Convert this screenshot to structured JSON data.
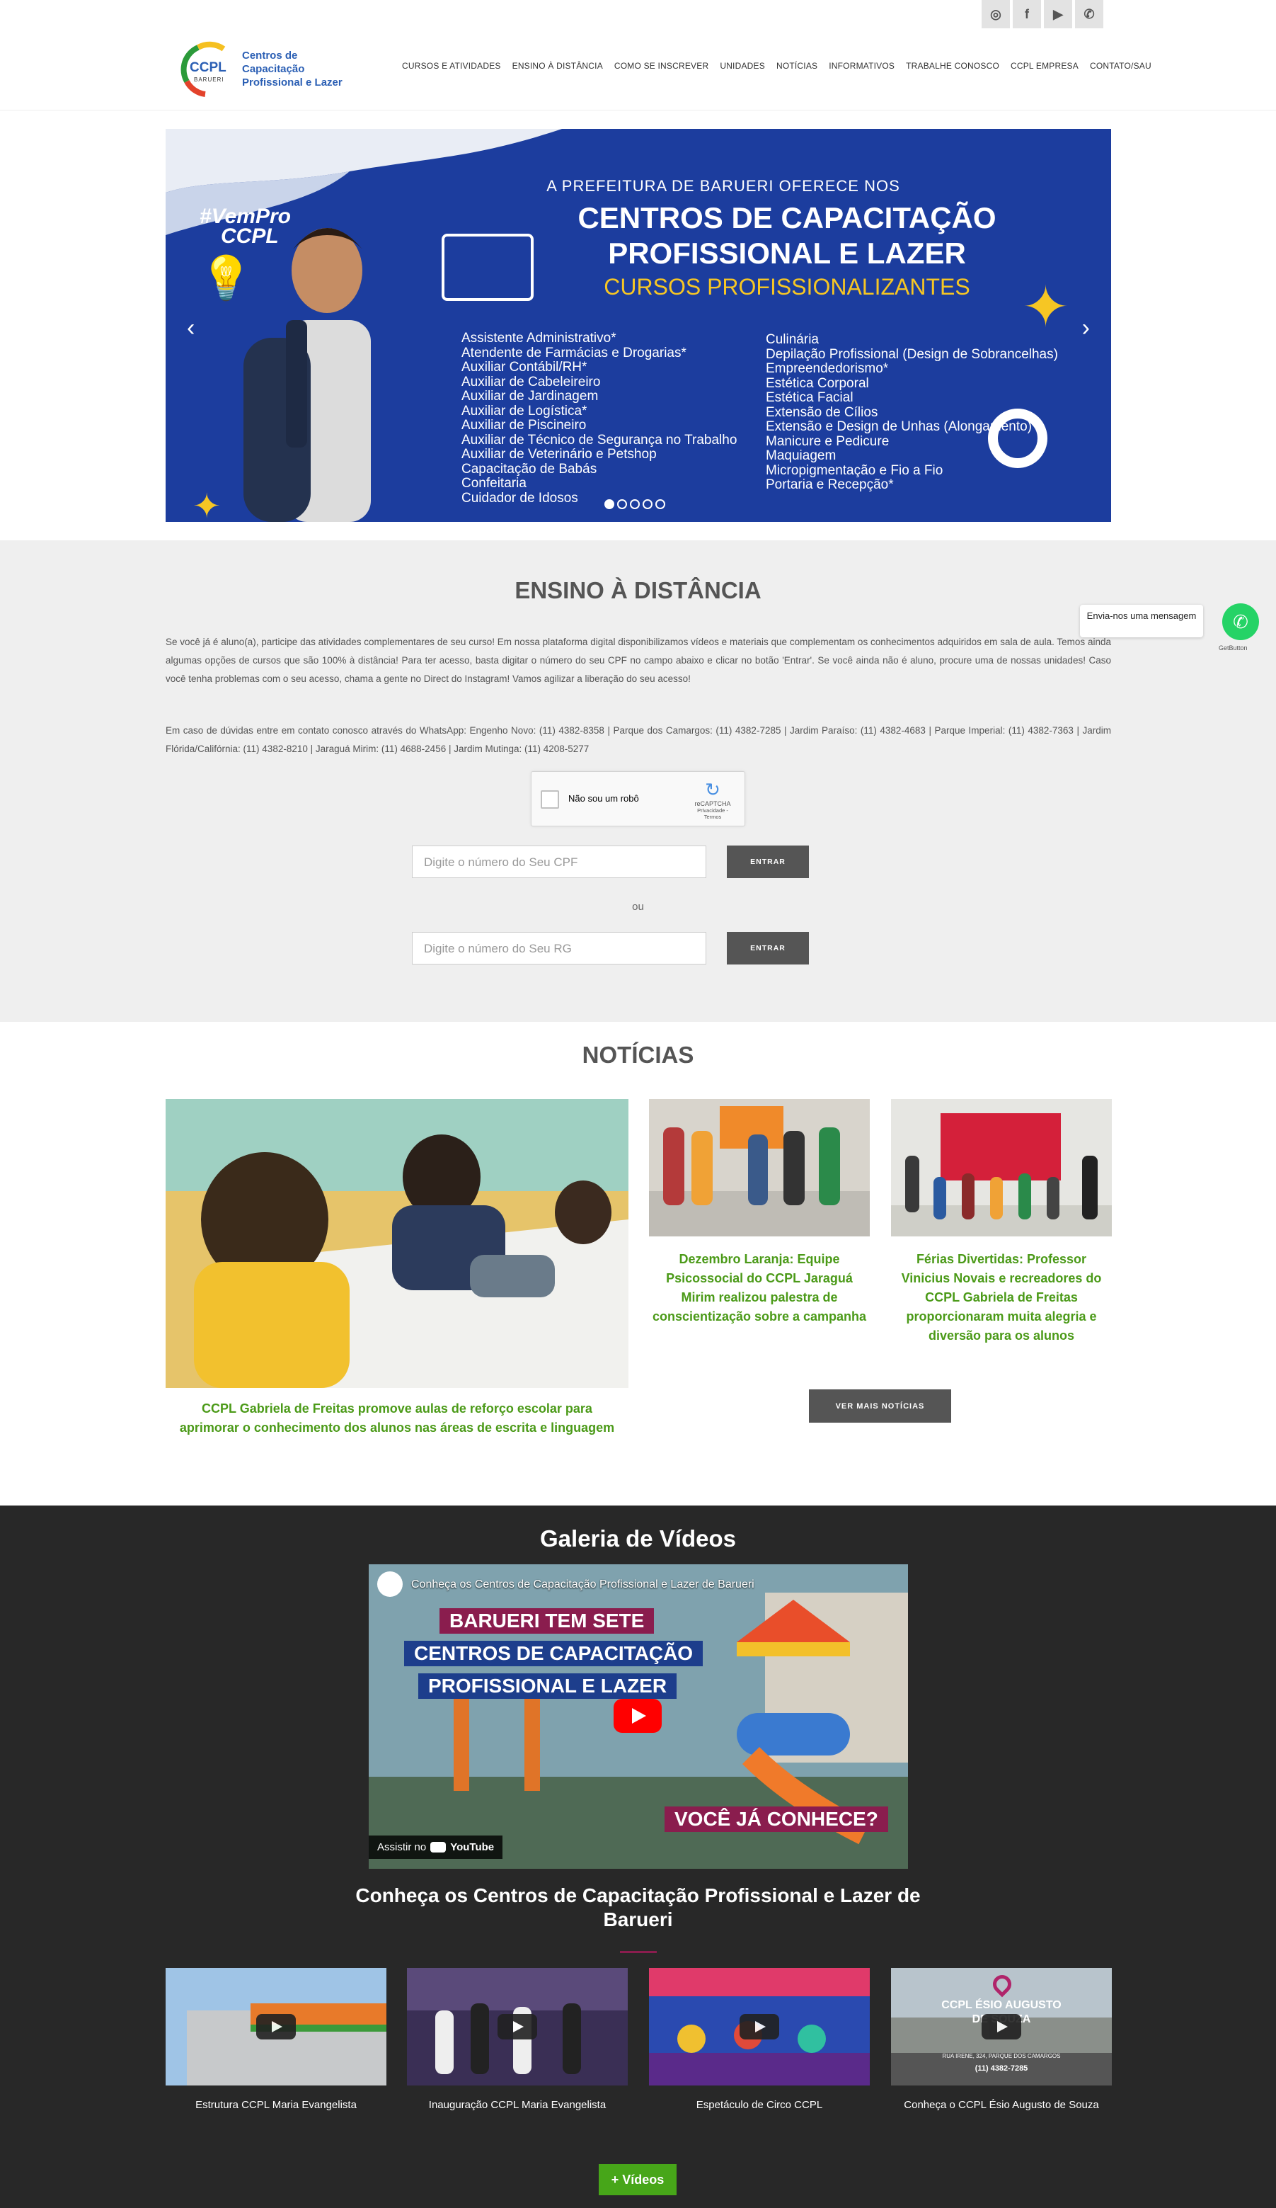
{
  "social": {
    "items": [
      {
        "icon": "instagram-icon",
        "glyph": "◎"
      },
      {
        "icon": "facebook-icon",
        "glyph": "f"
      },
      {
        "icon": "youtube-icon",
        "glyph": "▶"
      },
      {
        "icon": "whatsapp-icon",
        "glyph": "✆"
      }
    ]
  },
  "header": {
    "logo_abbr": "CCPL",
    "logo_city": "BARUERI",
    "logo_line1": "Centros de Capacitação",
    "logo_line2": "Profissional e Lazer",
    "nav": [
      "CURSOS E ATIVIDADES",
      "ENSINO À DISTÂNCIA",
      "COMO SE INSCREVER",
      "UNIDADES",
      "NOTÍCIAS",
      "INFORMATIVOS",
      "TRABALHE CONOSCO",
      "CCPL EMPRESA",
      "CONTATO/SAU"
    ]
  },
  "banner": {
    "hashtag_line1": "#VemPro",
    "hashtag_line2": "CCPL",
    "subtitle": "A PREFEITURA DE BARUERI OFERECE NOS",
    "title1": "CENTROS DE CAPACITAÇÃO",
    "title2": "PROFISSIONAL E LAZER",
    "title3": "CURSOS PROFISSIONALIZANTES",
    "courses_left": [
      "Assistente Administrativo*",
      "Atendente de Farmácias e Drogarias*",
      "Auxiliar Contábil/RH*",
      "Auxiliar de Cabeleireiro",
      "Auxiliar de Jardinagem",
      "Auxiliar de Logística*",
      "Auxiliar de Piscineiro",
      "Auxiliar de Técnico de Segurança no Trabalho",
      "Auxiliar de Veterinário e Petshop",
      "Capacitação de Babás",
      "Confeitaria",
      "Cuidador de Idosos"
    ],
    "courses_right": [
      "Culinária",
      "Depilação Profissional (Design de Sobrancelhas)",
      "Empreendedorismo*",
      "Estética Corporal",
      "Estética Facial",
      "Extensão de Cílios",
      "Extensão e Design de Unhas (Alongamento)",
      "Manicure e Pedicure",
      "Maquiagem",
      "Micropigmentação e Fio a Fio",
      "Portaria e Recepção*"
    ],
    "prev": "‹",
    "next": "›",
    "slides": 5,
    "active_slide": 1
  },
  "ead": {
    "title": "ENSINO À DISTÂNCIA",
    "paragraph1": "Se você já é aluno(a), participe das atividades complementares de seu curso! Em nossa plataforma digital disponibilizamos vídeos e materiais que complementam os conhecimentos adquiridos em sala de aula. Temos ainda algumas opções de cursos que são 100% à distância! Para ter acesso, basta digitar o número do seu CPF no campo abaixo e clicar no botão 'Entrar'. Se você ainda não é aluno, procure uma de nossas unidades! Caso você tenha problemas com o seu acesso, chama a gente no Direct do Instagram! Vamos agilizar a liberação do seu acesso!",
    "paragraph2": "Em caso de dúvidas entre em contato conosco através do WhatsApp: Engenho Novo: (11) 4382-8358 | Parque dos Camargos: (11) 4382-7285 | Jardim Paraíso: (11) 4382-4683 | Parque Imperial: (11) 4382-7363 | Jardim Flórida/Califórnia: (11) 4382-8210 | Jaraguá Mirim: (11) 4688-2456 | Jardim Mutinga: (11) 4208-5277",
    "captcha_label": "Não sou um robô",
    "captcha_brand": "reCAPTCHA",
    "captcha_links": "Privacidade - Termos",
    "cpf_placeholder": "Digite o número do Seu CPF",
    "rg_placeholder": "Digite o número do Seu RG",
    "enter_label": "ENTRAR",
    "or_label": "ou"
  },
  "whatsapp_float": {
    "tooltip": "Envia-nos uma mensagem",
    "caption": "GetButton"
  },
  "news": {
    "title": "NOTÍCIAS",
    "items": [
      {
        "title": "CCPL Gabriela de Freitas promove aulas de reforço escolar para aprimorar o conhecimento dos alunos nas áreas de escrita e linguagem"
      },
      {
        "title": "Dezembro Laranja: Equipe Psicossocial do CCPL Jaraguá Mirim realizou palestra de conscientização sobre a campanha"
      },
      {
        "title": "Férias Divertidas: Professor Vinicius Novais e recreadores do CCPL Gabriela de Freitas proporcionaram muita alegria e diversão para os alunos"
      }
    ],
    "more_label": "VER MAIS NOTÍCIAS"
  },
  "videos": {
    "title": "Galeria de Vídeos",
    "player_title": "Conheça os Centros de Capacitação Profissional e Lazer de Barueri",
    "player_banner1": "BARUERI TEM SETE",
    "player_banner2": "CENTROS DE CAPACITAÇÃO",
    "player_banner3": "PROFISSIONAL E LAZER",
    "player_banner4": "VOCÊ JÁ CONHECE?",
    "watch_on": "Assistir no",
    "youtube": "YouTube",
    "featured_title": "Conheça os Centros de Capacitação Profissional e Lazer de Barueri",
    "thumbs": [
      {
        "caption": "Estrutura CCPL Maria Evangelista"
      },
      {
        "caption": "Inauguração CCPL Maria Evangelista"
      },
      {
        "caption": "Espetáculo de Circo CCPL"
      },
      {
        "caption": "Conheça o CCPL Ésio Augusto de Souza"
      }
    ],
    "thumb4_overlay1": "CCPL ÉSIO AUGUSTO",
    "thumb4_overlay2": "DE SOUZA",
    "thumb4_addr": "RUA IRENE, 324, PARQUE DOS CAMARGOS",
    "thumb4_phone": "(11) 4382-7285",
    "more_label": "+ Vídeos"
  },
  "colors": {
    "brand_blue": "#1c3d9e",
    "accent_green": "#4b9a18",
    "button_green": "#47a619",
    "dark_button": "#555555",
    "dark_section": "#282828"
  }
}
